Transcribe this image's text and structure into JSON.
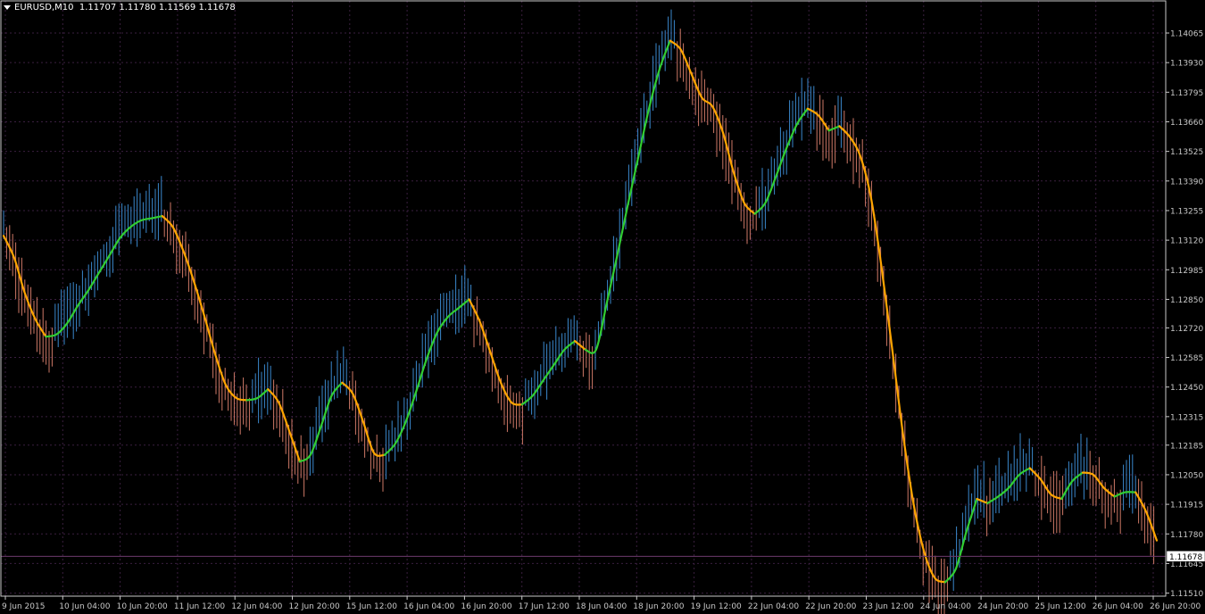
{
  "header": {
    "symbol_label": "EURUSD,M10",
    "ohlc_text": "1.11707 1.11780 1.11569 1.11678"
  },
  "colors": {
    "background": "#000000",
    "grid": "#3a1f3f",
    "axis": "#c8c8c8",
    "bull_bar": "#3d8fd8",
    "bear_bar": "#d9806b",
    "line_up": "#32cd32",
    "line_down": "#ffa500",
    "price_line": "#6b3a6b"
  },
  "chart_data": {
    "type": "line",
    "title": "",
    "ylim": [
      1.1145,
      1.1412
    ],
    "yticks": [
      1.14065,
      1.1393,
      1.13795,
      1.1366,
      1.13525,
      1.1339,
      1.13255,
      1.1312,
      1.12985,
      1.1285,
      1.1272,
      1.12585,
      1.1245,
      1.12315,
      1.12185,
      1.1205,
      1.11915,
      1.1178,
      1.11645,
      1.1151
    ],
    "ytick_labels": [
      "1.14065",
      "1.13930",
      "1.13795",
      "1.13660",
      "1.13525",
      "1.13390",
      "1.13255",
      "1.13120",
      "1.12985",
      "1.12850",
      "1.12720",
      "1.12585",
      "1.12450",
      "1.12315",
      "1.12185",
      "1.12050",
      "1.11915",
      "1.11780",
      "1.11645",
      "1.11510"
    ],
    "current_price": 1.11678,
    "current_price_label": "1.11678",
    "xticks": [
      "9 Jun 2015",
      "10 Jun 04:00",
      "10 Jun 20:00",
      "11 Jun 12:00",
      "12 Jun 04:00",
      "12 Jun 20:00",
      "15 Jun 12:00",
      "16 Jun 04:00",
      "16 Jun 20:00",
      "17 Jun 12:00",
      "18 Jun 04:00",
      "18 Jun 20:00",
      "19 Jun 12:00",
      "22 Jun 04:00",
      "22 Jun 20:00",
      "23 Jun 12:00",
      "24 Jun 04:00",
      "24 Jun 20:00",
      "25 Jun 12:00",
      "26 Jun 04:00",
      "26 Jun 20:00"
    ],
    "grid": true,
    "series": [
      {
        "values": [
          1.1314,
          1.1304,
          1.1288,
          1.1276,
          1.1268,
          1.1269,
          1.1274,
          1.1282,
          1.1289,
          1.1297,
          1.1305,
          1.1313,
          1.1318,
          1.1321,
          1.1322,
          1.1323,
          1.1318,
          1.1307,
          1.1293,
          1.1277,
          1.126,
          1.1246,
          1.124,
          1.1239,
          1.124,
          1.1244,
          1.1238,
          1.1225,
          1.1211,
          1.1214,
          1.1227,
          1.1241,
          1.1247,
          1.1242,
          1.1229,
          1.1215,
          1.1214,
          1.1219,
          1.1229,
          1.1243,
          1.1258,
          1.127,
          1.1277,
          1.1281,
          1.1285,
          1.1275,
          1.1261,
          1.1247,
          1.1238,
          1.1237,
          1.1241,
          1.1248,
          1.1255,
          1.1262,
          1.1266,
          1.1262,
          1.1262,
          1.1283,
          1.1305,
          1.1328,
          1.135,
          1.1372,
          1.139,
          1.1403,
          1.1399,
          1.1388,
          1.1377,
          1.1373,
          1.1361,
          1.1343,
          1.1329,
          1.1324,
          1.1329,
          1.1341,
          1.1354,
          1.1365,
          1.1372,
          1.1369,
          1.1362,
          1.1364,
          1.1359,
          1.135,
          1.1331,
          1.1299,
          1.1262,
          1.1224,
          1.1192,
          1.117,
          1.1158,
          1.1156,
          1.1162,
          1.1179,
          1.1194,
          1.1192,
          1.1195,
          1.1199,
          1.1205,
          1.1208,
          1.1203,
          1.1196,
          1.1194,
          1.1202,
          1.1206,
          1.1205,
          1.1199,
          1.1195,
          1.1197,
          1.1197,
          1.1188,
          1.1175
        ]
      }
    ]
  }
}
